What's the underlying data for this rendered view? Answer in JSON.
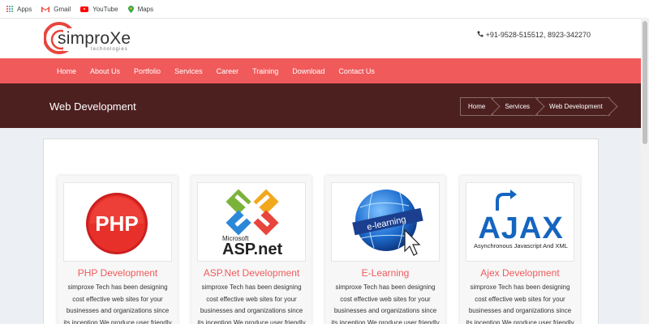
{
  "bookmarks": [
    {
      "label": "Apps",
      "icon": "apps-icon"
    },
    {
      "label": "Gmail",
      "icon": "gmail-icon"
    },
    {
      "label": "YouTube",
      "icon": "youtube-icon"
    },
    {
      "label": "Maps",
      "icon": "maps-icon"
    }
  ],
  "header": {
    "logo_text": "simproXe",
    "logo_sub": "technologies",
    "phone": "+91-9528-515512, 8923-342270"
  },
  "nav": [
    "Home",
    "About Us",
    "Portfolio",
    "Services",
    "Career",
    "Training",
    "Download",
    "Contact Us"
  ],
  "page": {
    "title": "Web Development",
    "breadcrumb": [
      "Home",
      "Services",
      "Web Development"
    ]
  },
  "cards": [
    {
      "title": "PHP Development",
      "image_text": "PHP",
      "text": "simproxe Tech has been designing cost effective web sites for your businesses and organizations since its inception.We produce user friendly"
    },
    {
      "title": "ASP.Net Development",
      "image_text": "Microsoft ASP.net",
      "text": "simproxe Tech has been designing cost effective web sites for your businesses and organizations since its inception.We produce user friendly"
    },
    {
      "title": "E-Learning",
      "image_text": "e-learning",
      "text": "simproxe Tech has been designing cost effective web sites for your businesses and organizations since its inception.We produce user friendly"
    },
    {
      "title": "Ajex Development",
      "image_text": "AJAX",
      "image_sub": "Asynchronous Javascript And XML",
      "text": "simproxe Tech has been designing cost effective web sites for your businesses and organizations since its inception.We produce user friendly"
    }
  ],
  "colors": {
    "accent": "#f05a5b",
    "band": "#4d2020"
  }
}
